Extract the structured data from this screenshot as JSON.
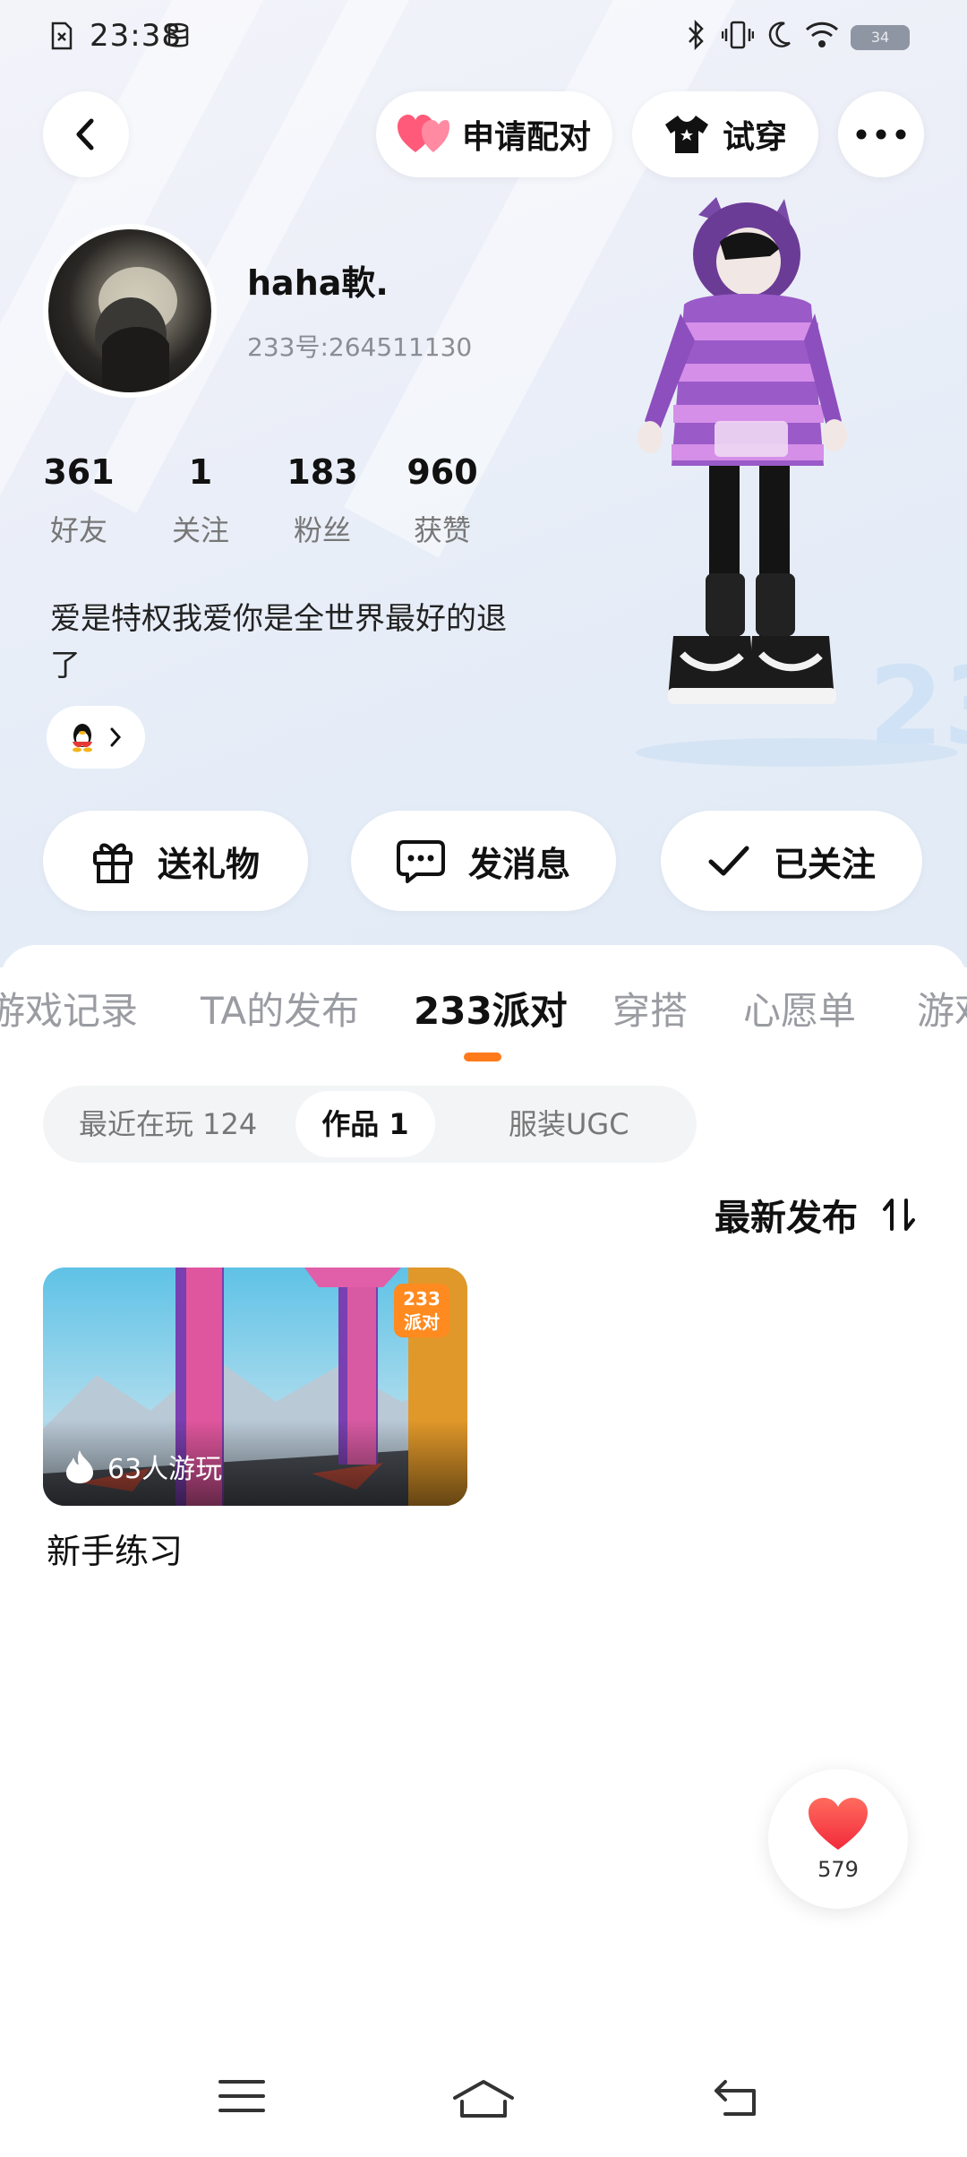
{
  "status_bar": {
    "time": "23:38",
    "battery": "34"
  },
  "top_nav": {
    "back_icon": "chevron-left-icon",
    "pair_label": "申请配对",
    "tryon_label": "试穿",
    "more_icon": "more-dots-icon",
    "heart_color": "#ff5a7a"
  },
  "profile": {
    "username": "haha軟.",
    "uid": "233号:264511130",
    "stats": [
      {
        "num": "361",
        "label": "好友"
      },
      {
        "num": "1",
        "label": "关注"
      },
      {
        "num": "183",
        "label": "粉丝"
      },
      {
        "num": "960",
        "label": "获赞"
      }
    ],
    "bio": "爱是特权我爱你是全世界最好的退了",
    "social_icon": "qq-penguin-icon"
  },
  "actions": {
    "gift_label": "送礼物",
    "message_label": "发消息",
    "follow_label": "已关注"
  },
  "tabs": [
    "游戏记录",
    "TA的发布",
    "233派对",
    "穿搭",
    "心愿单",
    "游戏"
  ],
  "active_tab": "233派对",
  "accent_color": "#ff7a1a",
  "subtabs": {
    "recent": "最近在玩 124",
    "works": "作品 1",
    "ugc": "服装UGC"
  },
  "sort_label": "最新发布",
  "works": [
    {
      "plays": "63人游玩",
      "badge_line1": "233",
      "badge_line2": "派对",
      "title": "新手练习"
    }
  ],
  "like_fab": {
    "count": "579"
  }
}
